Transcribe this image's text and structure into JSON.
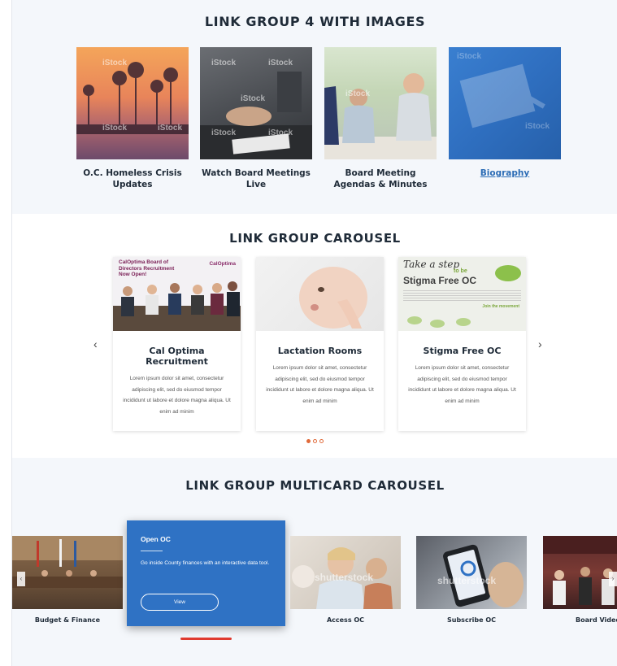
{
  "section1": {
    "title": "LINK GROUP 4 WITH IMAGES",
    "tiles": [
      {
        "caption": "O.C. Homeless Crisis Updates",
        "watermark": "iStock"
      },
      {
        "caption": "Watch Board Meetings Live",
        "watermark": "iStock"
      },
      {
        "caption": "Board Meeting Agendas & Minutes",
        "watermark": "iStock"
      },
      {
        "caption": "Biography",
        "watermark": "iStock"
      }
    ]
  },
  "section2": {
    "title": "LINK GROUP CAROUSEL",
    "prev_arrow": "‹",
    "next_arrow": "›",
    "cards": [
      {
        "title": "Cal Optima Recruitment",
        "img_text": "CalOptima Board of Directors Recruitment Now Open!",
        "logo_text": "CalOptima",
        "body": "Lorem ipsum dolor sit amet, consectetur adipiscing elit, sed do eiusmod tempor incididunt ut labore et dolore magna aliqua. Ut enim ad minim"
      },
      {
        "title": "Lactation Rooms",
        "body": "Lorem ipsum dolor sit amet, consectetur adipiscing elit, sed do eiusmod tempor incididunt ut labore et dolore magna aliqua. Ut enim ad minim"
      },
      {
        "title": "Stigma Free OC",
        "img_text_1": "Take a step",
        "img_text_2": "to be",
        "img_text_3": "Stigma Free OC",
        "img_text_4": "Join the movement",
        "body": "Lorem ipsum dolor sit amet, consectetur adipiscing elit, sed do eiusmod tempor incididunt ut labore et dolore magna aliqua. Ut enim ad minim"
      }
    ]
  },
  "section3": {
    "title": "LINK GROUP MULTICARD CAROUSEL",
    "feature": {
      "title": "Open OC",
      "description": "Go inside County finances with an interactive data tool.",
      "button": "View"
    },
    "cards": [
      {
        "caption": "Budget & Finance"
      },
      {
        "caption": "Access OC",
        "watermark": "shutterstock"
      },
      {
        "caption": "Subscribe OC",
        "watermark": "shutterstock"
      },
      {
        "caption": "Board Video"
      }
    ],
    "prev_arrow": "‹",
    "next_arrow": "›"
  },
  "colors": {
    "accent_blue": "#2f72c4",
    "link_blue": "#2b6cb5",
    "carousel_dot": "#e06a3a",
    "active_bar": "#e03a2f"
  }
}
